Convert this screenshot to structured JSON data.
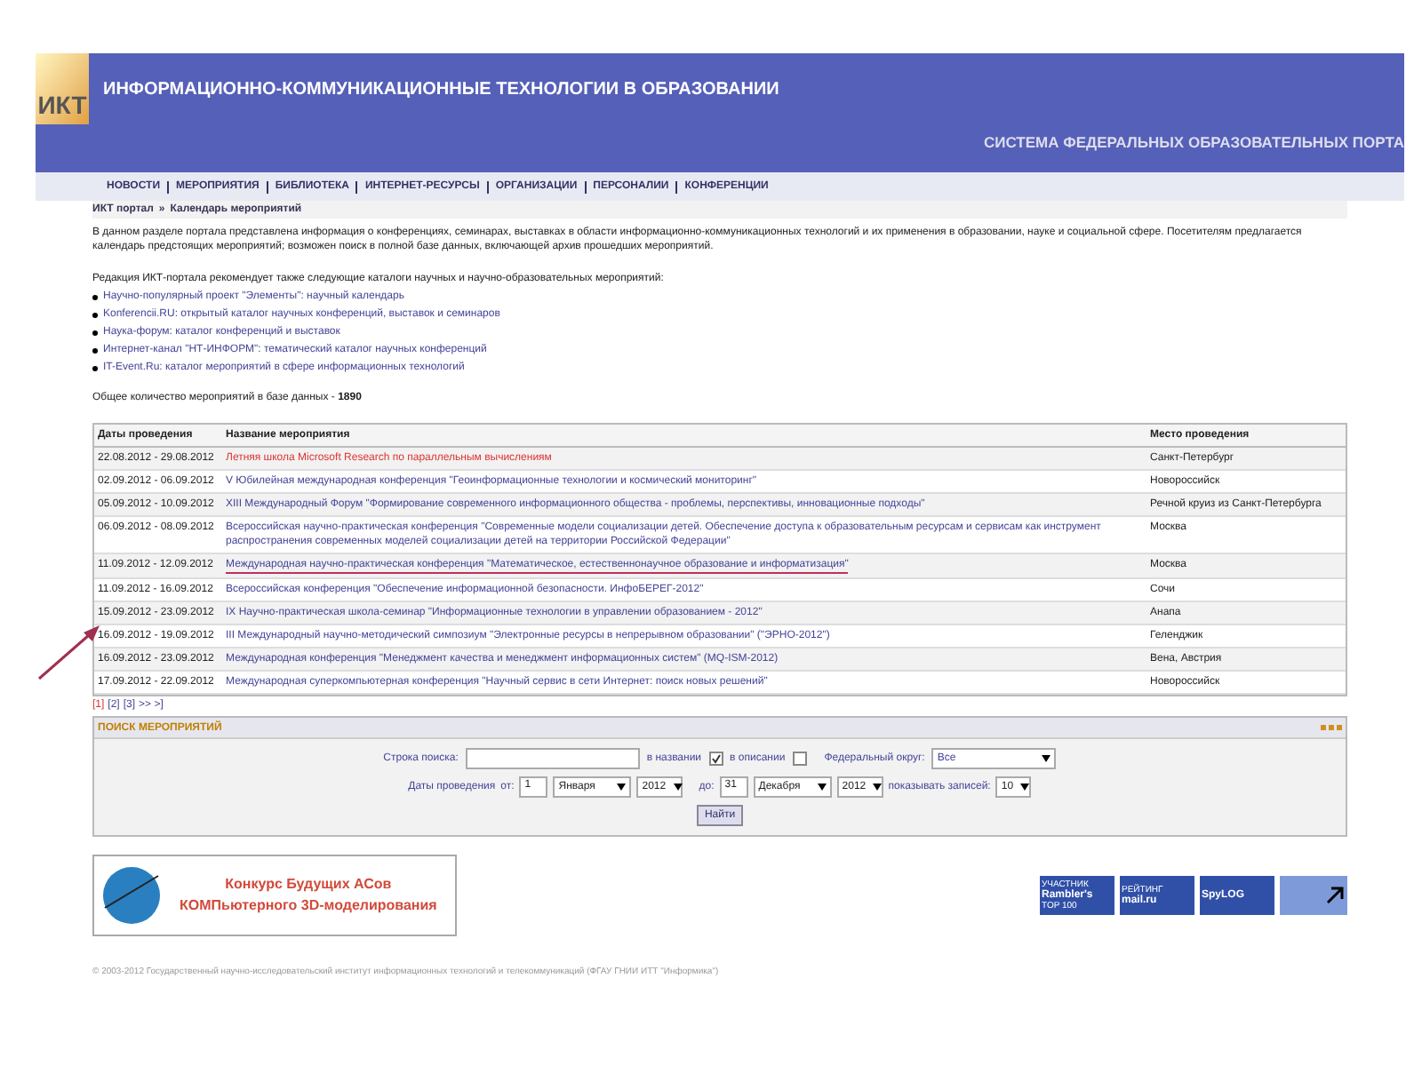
{
  "header": {
    "logo": "ИКТ",
    "title": "ИНФОРМАЦИОННО-КОММУНИКАЦИОННЫЕ ТЕХНОЛОГИИ В ОБРАЗОВАНИИ",
    "subtitle": "СИСТЕМА ФЕДЕРАЛЬНЫХ ОБРАЗОВАТЕЛЬНЫХ ПОРТА"
  },
  "nav": [
    "НОВОСТИ",
    "МЕРОПРИЯТИЯ",
    "БИБЛИОТЕКА",
    "ИНТЕРНЕТ-РЕСУРСЫ",
    "ОРГАНИЗАЦИИ",
    "ПЕРСОНАЛИИ",
    "КОНФЕРЕНЦИИ"
  ],
  "breadcrumb": {
    "items": [
      "ИКТ портал",
      "Календарь мероприятий"
    ],
    "separator": "»"
  },
  "intro": "В данном разделе портала представлена информация о конференциях, семинарах, выставках в области информационно-коммуникационных технологий и их применения в образовании, науке и социальной сфере. Посетителям предлагается календарь предстоящих мероприятий; возможен поиск в полной базе данных, включающей архив прошедших мероприятий.",
  "recommend": "Редакция ИКТ-портала рекомендует также следующие каталоги научных и научно-образовательных мероприятий:",
  "catalogs": [
    "Научно-популярный проект \"Элементы\": научный календарь",
    "Konferencii.RU: открытый каталог научных конференций, выставок и семинаров",
    "Наука-форум: каталог конференций и выставок",
    "Интернет-канал \"НТ-ИНФОРМ\": тематический каталог научных конференций",
    "IT-Event.Ru: каталог мероприятий в сфере информационных технологий"
  ],
  "total": "Общее количество мероприятий в базе данных - **1890**",
  "table": {
    "columns": [
      "Даты проведения",
      "Название мероприятия",
      "Место проведения"
    ],
    "rows": [
      {
        "dates": "22.08.2012 - 29.08.2012",
        "name": "Летняя школа Microsoft Research по параллельным вычислениям",
        "place": "Санкт-Петербург",
        "current": true,
        "marked": false
      },
      {
        "dates": "02.09.2012 - 06.09.2012",
        "name": "V Юбилейная международная конференция \"Геоинформационные технологии и космический мониторинг\"",
        "place": "Новороссийск",
        "current": false,
        "marked": false
      },
      {
        "dates": "05.09.2012 - 10.09.2012",
        "name": "XIII Международный Форум \"Формирование современного информационного общества - проблемы, перспективы, инновационные подходы\"",
        "place": "Речной круиз из Санкт-Петербурга",
        "current": false,
        "marked": false
      },
      {
        "dates": "06.09.2012 - 08.09.2012",
        "name": "Всероссийская научно-практическая конференция \"Современные модели социализации детей. Обеспечение доступа к образовательным ресурсам и сервисам как инструмент распространения современных моделей социализации детей на территории Российской Федерации\"",
        "place": "Москва",
        "current": false,
        "marked": false
      },
      {
        "dates": "11.09.2012 - 12.09.2012",
        "name": "Международная научно-практическая конференция \"Математическое, естественнонаучное образование и информатизация\"",
        "place": "Москва",
        "current": false,
        "marked": true
      },
      {
        "dates": "11.09.2012 - 16.09.2012",
        "name": "Всероссийская конференция \"Обеспечение информационной безопасности. ИнфоБЕРЕГ-2012\"",
        "place": "Сочи",
        "current": false,
        "marked": false
      },
      {
        "dates": "15.09.2012 - 23.09.2012",
        "name": "IX Научно-практическая школа-семинар \"Информационные технологии в управлении образованием - 2012\"",
        "place": "Анапа",
        "current": false,
        "marked": false
      },
      {
        "dates": "16.09.2012 - 19.09.2012",
        "name": "III Международный научно-методический симпозиум \"Электронные ресурсы в непрерывном образовании\" (\"ЭРНО-2012\")",
        "place": "Геленджик",
        "current": false,
        "marked": false
      },
      {
        "dates": "16.09.2012 - 23.09.2012",
        "name": "Международная конференция \"Менеджмент качества и менеджмент информационных систем\" (MQ-ISM-2012)",
        "place": "Вена, Австрия",
        "current": false,
        "marked": false
      },
      {
        "dates": "17.09.2012 - 22.09.2012",
        "name": "Международная суперкомпьютерная конференция \"Научный сервис в сети Интернет: поиск новых решений\"",
        "place": "Новороссийск",
        "current": false,
        "marked": false
      }
    ]
  },
  "pagination": {
    "pages": [
      {
        "label": "[1]",
        "selected": true
      },
      {
        "label": "[2]",
        "selected": false
      },
      {
        "label": "[3]",
        "selected": false
      }
    ],
    "next": ">> >]"
  },
  "search": {
    "title": "ПОИСК МЕРОПРИЯТИЙ",
    "query_label": "Строка поиска:",
    "in_title": {
      "label": "в названии",
      "checked": true
    },
    "in_description": {
      "label": "в описании",
      "checked": false
    },
    "district_label": "Федеральный округ:",
    "district": "Все",
    "dates_label": "Даты проведения",
    "from_label": "от:",
    "from_day": "1",
    "from_month": "Января",
    "from_year": "2012",
    "to_label": "до:",
    "to_day": "31",
    "to_month": "Декабря",
    "to_year": "2012",
    "count_label": "показывать записей:",
    "count": "10",
    "button": "Найти"
  },
  "banner": {
    "line1": "Конкурс Будущих АСов",
    "line2": "КОМПьютерного 3D-моделирования"
  },
  "counters": [
    {
      "top": "УЧАСТНИК",
      "bottom": "Rambler's",
      "badge": "TOP 100"
    },
    {
      "top": "РЕЙТИНГ",
      "bottom": "mail.ru"
    },
    {
      "bottom": "SpyLOG"
    }
  ],
  "copyright": "© 2003-2012 Государственный научно-исследовательский институт информационных технологий и телекоммуникаций (ФГАУ ГНИИ ИТТ \"Информика\")"
}
